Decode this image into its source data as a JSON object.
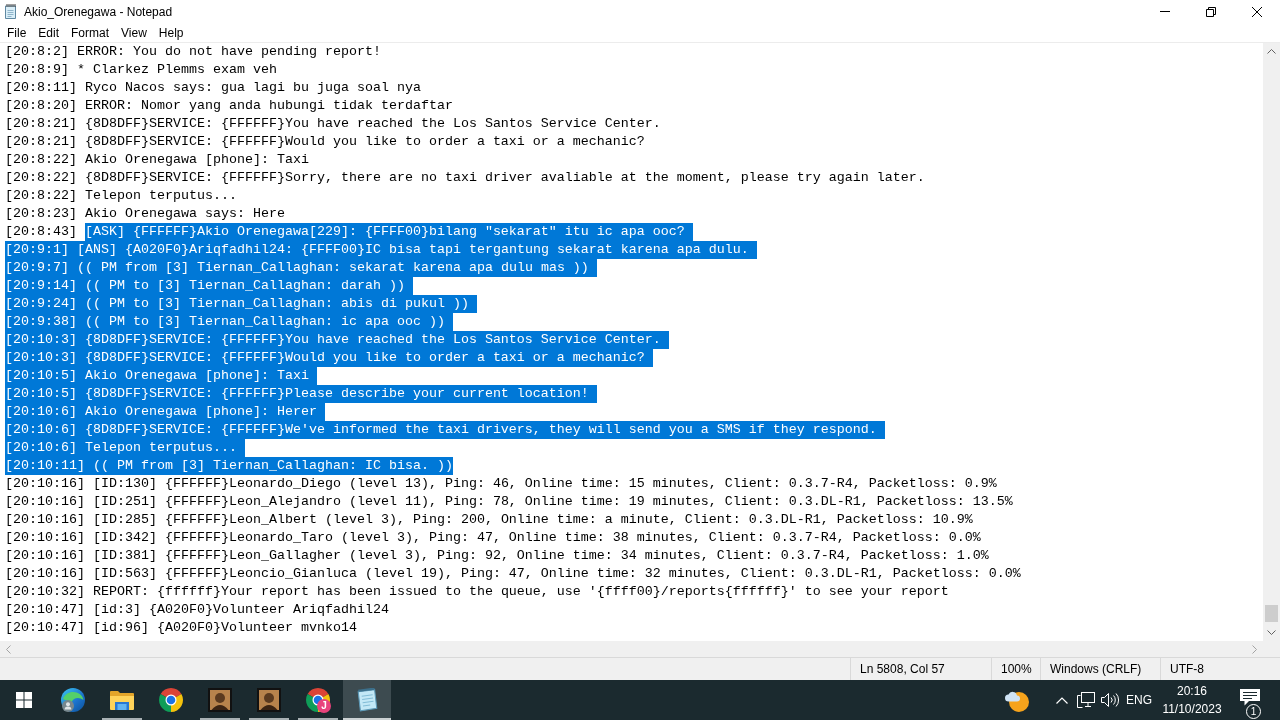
{
  "window": {
    "title": "Akio_Orenegawa - Notepad"
  },
  "menu": [
    "File",
    "Edit",
    "Format",
    "View",
    "Help"
  ],
  "lines": [
    {
      "stamp": "[20:8:2]",
      "message": "ERROR: You do not have pending report!",
      "stamp_selected": false,
      "message_selected": false
    },
    {
      "stamp": "[20:8:9]",
      "message": "* Clarkez Plemms exam veh",
      "stamp_selected": false,
      "message_selected": false
    },
    {
      "stamp": "[20:8:11]",
      "message": "Ryco Nacos says: gua lagi bu juga soal nya",
      "stamp_selected": false,
      "message_selected": false
    },
    {
      "stamp": "[20:8:20]",
      "message": "ERROR: Nomor yang anda hubungi tidak terdaftar",
      "stamp_selected": false,
      "message_selected": false
    },
    {
      "stamp": "[20:8:21]",
      "message": "{8D8DFF}SERVICE: {FFFFFF}You have reached the Los Santos Service Center.",
      "stamp_selected": false,
      "message_selected": false
    },
    {
      "stamp": "[20:8:21]",
      "message": "{8D8DFF}SERVICE: {FFFFFF}Would you like to order a taxi or a mechanic?",
      "stamp_selected": false,
      "message_selected": false
    },
    {
      "stamp": "[20:8:22]",
      "message": "Akio Orenegawa [phone]: Taxi",
      "stamp_selected": false,
      "message_selected": false
    },
    {
      "stamp": "[20:8:22]",
      "message": "{8D8DFF}SERVICE: {FFFFFF}Sorry, there are no taxi driver avaliable at the moment, please try again later.",
      "stamp_selected": false,
      "message_selected": false
    },
    {
      "stamp": "[20:8:22]",
      "message": "Telepon terputus...",
      "stamp_selected": false,
      "message_selected": false
    },
    {
      "stamp": "[20:8:23]",
      "message": "Akio Orenegawa says: Here",
      "stamp_selected": false,
      "message_selected": false
    },
    {
      "stamp": "[20:8:43]",
      "message": "[ASK] {FFFFFF}Akio Orenegawa[229]: {FFFF00}bilang \"sekarat\" itu ic apa ooc?",
      "stamp_selected": false,
      "message_selected": true
    },
    {
      "stamp": "[20:9:1]",
      "message": "[ANS] {A020F0}Ariqfadhil24: {FFFF00}IC bisa tapi tergantung sekarat karena apa dulu.",
      "stamp_selected": true,
      "message_selected": true
    },
    {
      "stamp": "[20:9:7]",
      "message": "(( PM from [3] Tiernan_Callaghan: sekarat karena apa dulu mas ))",
      "stamp_selected": true,
      "message_selected": true
    },
    {
      "stamp": "[20:9:14]",
      "message": "(( PM to [3] Tiernan_Callaghan: darah ))",
      "stamp_selected": true,
      "message_selected": true
    },
    {
      "stamp": "[20:9:24]",
      "message": "(( PM to [3] Tiernan_Callaghan: abis di pukul ))",
      "stamp_selected": true,
      "message_selected": true
    },
    {
      "stamp": "[20:9:38]",
      "message": "(( PM to [3] Tiernan_Callaghan: ic apa ooc ))",
      "stamp_selected": true,
      "message_selected": true
    },
    {
      "stamp": "[20:10:3]",
      "message": "{8D8DFF}SERVICE: {FFFFFF}You have reached the Los Santos Service Center.",
      "stamp_selected": true,
      "message_selected": true
    },
    {
      "stamp": "[20:10:3]",
      "message": "{8D8DFF}SERVICE: {FFFFFF}Would you like to order a taxi or a mechanic?",
      "stamp_selected": true,
      "message_selected": true
    },
    {
      "stamp": "[20:10:5]",
      "message": "Akio Orenegawa [phone]: Taxi",
      "stamp_selected": true,
      "message_selected": true
    },
    {
      "stamp": "[20:10:5]",
      "message": "{8D8DFF}SERVICE: {FFFFFF}Please describe your current location!",
      "stamp_selected": true,
      "message_selected": true
    },
    {
      "stamp": "[20:10:6]",
      "message": "Akio Orenegawa [phone]: Herer",
      "stamp_selected": true,
      "message_selected": true
    },
    {
      "stamp": "[20:10:6]",
      "message": "{8D8DFF}SERVICE: {FFFFFF}We've informed the taxi drivers, they will send you a SMS if they respond.",
      "stamp_selected": true,
      "message_selected": true
    },
    {
      "stamp": "[20:10:6]",
      "message": "Telepon terputus...",
      "stamp_selected": true,
      "message_selected": true
    },
    {
      "stamp": "[20:10:11]",
      "message": "(( PM from [3] Tiernan_Callaghan: IC bisa. ))",
      "stamp_selected": true,
      "message_selected": true
    },
    {
      "stamp": "[20:10:16]",
      "message": "[ID:130] {FFFFFF}Leonardo_Diego (level 13), Ping: 46, Online time: 15 minutes, Client: 0.3.7-R4, Packetloss: 0.9%",
      "stamp_selected": false,
      "message_selected": false
    },
    {
      "stamp": "[20:10:16]",
      "message": "[ID:251] {FFFFFF}Leon_Alejandro (level 11), Ping: 78, Online time: 19 minutes, Client: 0.3.DL-R1, Packetloss: 13.5%",
      "stamp_selected": false,
      "message_selected": false
    },
    {
      "stamp": "[20:10:16]",
      "message": "[ID:285] {FFFFFF}Leon_Albert (level 3), Ping: 200, Online time: a minute, Client: 0.3.DL-R1, Packetloss: 10.9%",
      "stamp_selected": false,
      "message_selected": false
    },
    {
      "stamp": "[20:10:16]",
      "message": "[ID:342] {FFFFFF}Leonardo_Taro (level 3), Ping: 47, Online time: 38 minutes, Client: 0.3.7-R4, Packetloss: 0.0%",
      "stamp_selected": false,
      "message_selected": false
    },
    {
      "stamp": "[20:10:16]",
      "message": "[ID:381] {FFFFFF}Leon_Gallagher (level 3), Ping: 92, Online time: 34 minutes, Client: 0.3.7-R4, Packetloss: 1.0%",
      "stamp_selected": false,
      "message_selected": false
    },
    {
      "stamp": "[20:10:16]",
      "message": "[ID:563] {FFFFFF}Leoncio_Gianluca (level 19), Ping: 47, Online time: 32 minutes, Client: 0.3.DL-R1, Packetloss: 0.0%",
      "stamp_selected": false,
      "message_selected": false
    },
    {
      "stamp": "[20:10:32]",
      "message": "REPORT: {ffffff}Your report has been issued to the queue, use '{ffff00}/reports{ffffff}' to see your report",
      "stamp_selected": false,
      "message_selected": false
    },
    {
      "stamp": "[20:10:47]",
      "message": "[id:3] {A020F0}Volunteer Ariqfadhil24",
      "stamp_selected": false,
      "message_selected": false
    },
    {
      "stamp": "[20:10:47]",
      "message": "[id:96] {A020F0}Volunteer mvnko14",
      "stamp_selected": false,
      "message_selected": false
    }
  ],
  "status_bar": [
    "Ln 5808, Col 57",
    "100%",
    "Windows (CRLF)",
    "UTF-8"
  ],
  "taskbar": {
    "apps": [
      {
        "kind": "start",
        "running": false,
        "active": false
      },
      {
        "kind": "edge",
        "running": false,
        "active": false
      },
      {
        "kind": "folder",
        "running": true,
        "active": false
      },
      {
        "kind": "chrome",
        "running": false,
        "active": false
      },
      {
        "kind": "portrait",
        "running": true,
        "active": false
      },
      {
        "kind": "portrait",
        "running": true,
        "active": false
      },
      {
        "kind": "chrome",
        "badge": "J",
        "running": true,
        "active": false
      },
      {
        "kind": "notepad",
        "running": true,
        "active": true
      }
    ],
    "tray": {
      "language": "ENG",
      "time": "20:16",
      "date": "11/10/2023",
      "notifications": "1"
    }
  }
}
